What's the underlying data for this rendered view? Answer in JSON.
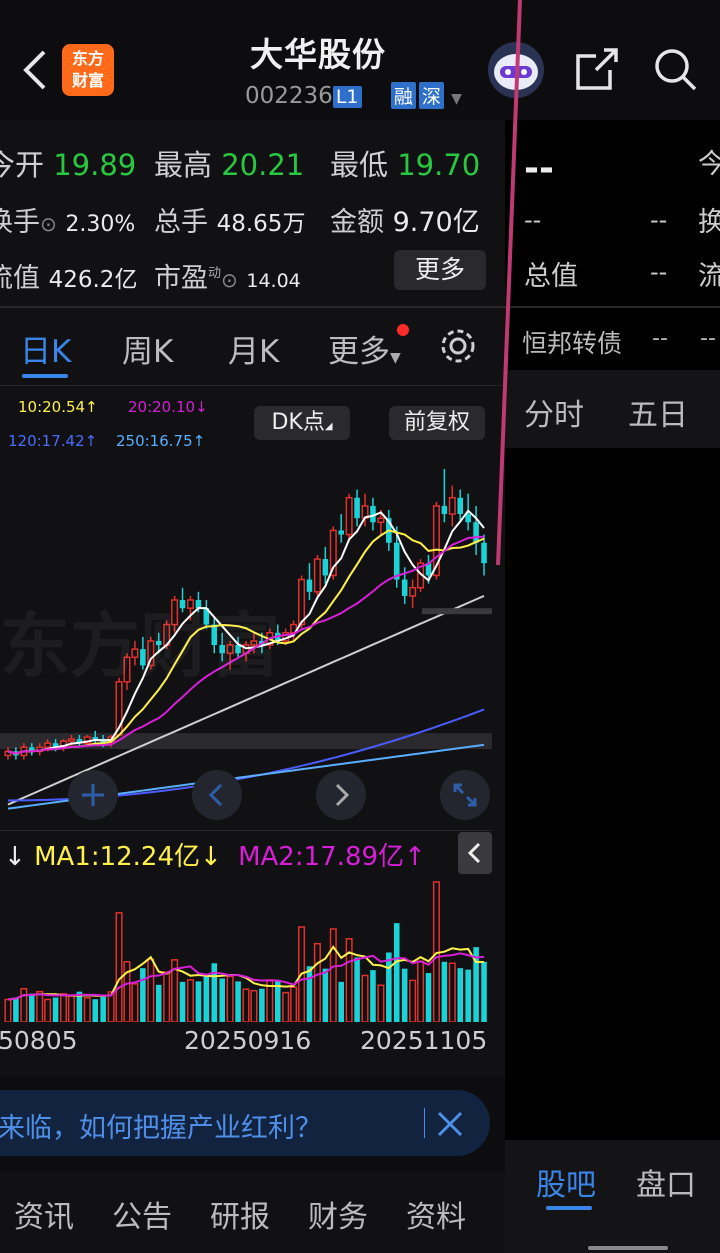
{
  "header": {
    "title": "大华股份",
    "code": "002236",
    "code_tag": "L1",
    "tag_margin": "融",
    "tag_market": "深",
    "logo_line1": "东方",
    "logo_line2": "财富"
  },
  "quotes": {
    "open_label": "今开",
    "open_value": "19.89",
    "high_label": "最高",
    "high_value": "20.21",
    "low_label": "最低",
    "low_value": "19.70",
    "turnover_label": "换手",
    "turnover_value": "2.30%",
    "volume_label": "总手",
    "volume_value": "48.65万",
    "amount_label": "金额",
    "amount_value": "9.70亿",
    "mcap_label": "流值",
    "mcap_value": "426.2亿",
    "pe_label": "市盈",
    "pe_sup": "动",
    "pe_value": "14.04",
    "more_button": "更多"
  },
  "right_panel": {
    "price": "--",
    "col1_a": "--",
    "col1_b": "--",
    "total_label": "总值",
    "total_value": "--",
    "cut_label_1": "今",
    "cut_label_2": "换",
    "cut_label_3": "流",
    "bond_label": "恒邦转债",
    "bond_v1": "--",
    "bond_v2": "--",
    "tab_fenshi": "分时",
    "tab_wuri": "五日"
  },
  "chart_tabs": [
    "日K",
    "周K",
    "月K",
    "更多"
  ],
  "ma_legend": {
    "ma10": "10:20.54↑",
    "ma20": "20:20.10↓",
    "ma120": "120:17.42↑",
    "ma250": "250:16.75↑",
    "dk_button": "DK点",
    "adjust_button": "前复权"
  },
  "watermark": "东方财富",
  "volume_legend": {
    "prefix": "↓",
    "ma1": "MA1:12.24亿↓",
    "ma2": "MA2:17.89亿↑"
  },
  "dates": [
    "50805",
    "20250916",
    "20251105"
  ],
  "banner": {
    "text": "来临，如何把握产业红利？"
  },
  "bottom_tabs_left": [
    "资讯",
    "公告",
    "研报",
    "财务",
    "资料"
  ],
  "bottom_tabs_right": [
    "股吧",
    "盘口"
  ],
  "colors": {
    "up": "#e0312b",
    "down": "#19d3d6",
    "ma10": "#fff14a",
    "ma20": "#d61fd6",
    "ma5": "#ffffff",
    "ma60": "#cfcfcf",
    "ma120": "#4a5cff",
    "ma250": "#5aaeff",
    "accent": "#2f7ae5"
  },
  "chart_data": {
    "type": "candlestick",
    "candles": [
      [
        16.5,
        16.7,
        16.4,
        16.6
      ],
      [
        16.6,
        16.7,
        16.4,
        16.5
      ],
      [
        16.5,
        16.8,
        16.4,
        16.7
      ],
      [
        16.7,
        16.8,
        16.5,
        16.6
      ],
      [
        16.6,
        16.8,
        16.5,
        16.7
      ],
      [
        16.7,
        16.9,
        16.6,
        16.8
      ],
      [
        16.8,
        16.9,
        16.6,
        16.7
      ],
      [
        16.7,
        16.9,
        16.6,
        16.85
      ],
      [
        16.85,
        17.0,
        16.7,
        16.9
      ],
      [
        16.9,
        17.0,
        16.7,
        16.8
      ],
      [
        16.8,
        17.0,
        16.7,
        16.95
      ],
      [
        16.95,
        17.1,
        16.8,
        16.9
      ],
      [
        16.9,
        17.0,
        16.7,
        16.8
      ],
      [
        16.8,
        17.0,
        16.7,
        16.95
      ],
      [
        17.0,
        18.4,
        17.0,
        18.3
      ],
      [
        18.3,
        19.0,
        18.1,
        18.9
      ],
      [
        18.9,
        19.3,
        18.7,
        19.1
      ],
      [
        19.1,
        19.4,
        18.6,
        18.7
      ],
      [
        18.7,
        19.4,
        18.6,
        19.3
      ],
      [
        19.3,
        19.5,
        19.0,
        19.2
      ],
      [
        19.2,
        19.8,
        19.1,
        19.7
      ],
      [
        19.7,
        20.4,
        19.5,
        20.3
      ],
      [
        20.3,
        20.6,
        20.0,
        20.1
      ],
      [
        20.1,
        20.4,
        19.8,
        20.3
      ],
      [
        20.3,
        20.5,
        20.0,
        20.1
      ],
      [
        20.1,
        20.3,
        19.6,
        19.7
      ],
      [
        19.7,
        19.9,
        19.0,
        19.2
      ],
      [
        19.2,
        19.5,
        18.8,
        19.0
      ],
      [
        19.0,
        19.3,
        18.6,
        19.2
      ],
      [
        19.2,
        19.4,
        18.9,
        19.0
      ],
      [
        19.0,
        19.3,
        18.8,
        19.2
      ],
      [
        19.2,
        19.5,
        19.0,
        19.3
      ],
      [
        19.3,
        19.5,
        19.0,
        19.2
      ],
      [
        19.2,
        19.6,
        19.1,
        19.5
      ],
      [
        19.5,
        19.7,
        19.2,
        19.3
      ],
      [
        19.3,
        19.6,
        19.2,
        19.5
      ],
      [
        19.5,
        19.8,
        19.3,
        19.7
      ],
      [
        19.7,
        20.9,
        19.6,
        20.8
      ],
      [
        20.8,
        21.2,
        20.3,
        20.5
      ],
      [
        20.5,
        21.4,
        20.4,
        21.3
      ],
      [
        21.3,
        21.6,
        20.7,
        20.9
      ],
      [
        20.9,
        22.1,
        20.8,
        22.0
      ],
      [
        22.0,
        22.4,
        21.7,
        21.9
      ],
      [
        21.9,
        22.9,
        21.8,
        22.8
      ],
      [
        22.8,
        23.0,
        22.1,
        22.3
      ],
      [
        22.3,
        22.9,
        22.1,
        22.6
      ],
      [
        22.6,
        22.8,
        22.0,
        22.2
      ],
      [
        22.2,
        22.5,
        21.9,
        22.3
      ],
      [
        22.3,
        22.5,
        21.5,
        21.7
      ],
      [
        21.7,
        22.1,
        20.6,
        20.8
      ],
      [
        20.8,
        21.1,
        20.2,
        20.4
      ],
      [
        20.4,
        20.8,
        20.1,
        20.6
      ],
      [
        20.6,
        21.3,
        20.5,
        21.2
      ],
      [
        21.2,
        21.4,
        20.7,
        20.9
      ],
      [
        20.9,
        22.7,
        20.8,
        22.6
      ],
      [
        22.6,
        23.5,
        22.2,
        22.4
      ],
      [
        22.4,
        23.1,
        22.1,
        22.8
      ],
      [
        22.8,
        23.0,
        22.2,
        22.4
      ],
      [
        22.4,
        22.9,
        22.0,
        22.2
      ],
      [
        22.2,
        22.6,
        21.4,
        21.7
      ],
      [
        21.7,
        21.9,
        20.9,
        21.2
      ]
    ],
    "ma": {
      "ma5_approx": "white",
      "ma10": "yellow",
      "ma20": "magenta",
      "ma60": "gray",
      "ma120": "blue",
      "ma250": "lightblue"
    }
  }
}
